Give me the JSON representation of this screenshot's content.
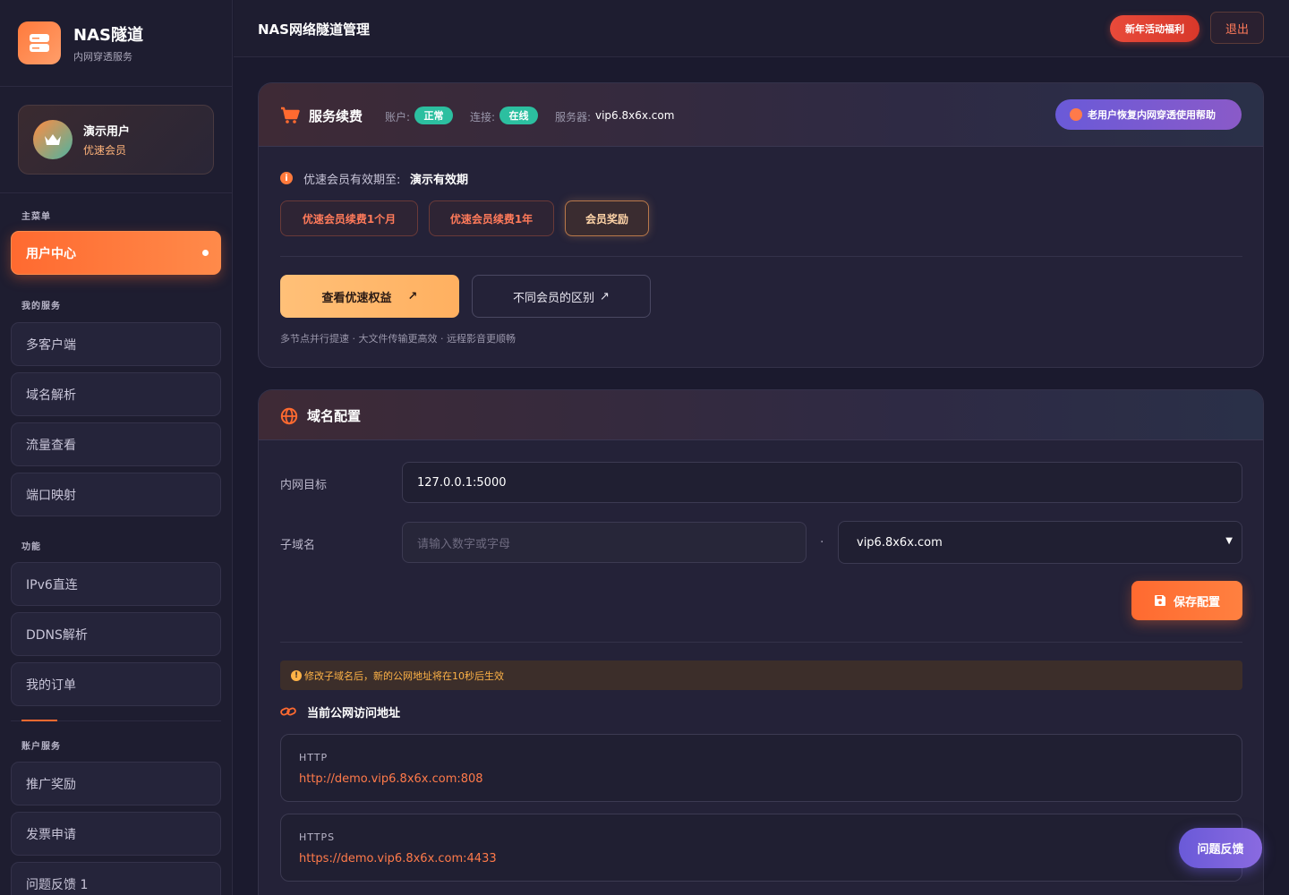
{
  "brand": {
    "name": "NAS隧道",
    "subtitle": "内网穿透服务"
  },
  "user": {
    "name": "演示用户",
    "level": "优速会员"
  },
  "sidebar": {
    "sections": {
      "main": "主菜单",
      "services": "我的服务",
      "features": "功能",
      "account": "账户服务"
    },
    "main_items": [
      {
        "label": "用户中心",
        "active": true
      }
    ],
    "service_items": [
      {
        "label": "多客户端"
      },
      {
        "label": "域名解析"
      },
      {
        "label": "流量查看"
      },
      {
        "label": "端口映射"
      }
    ],
    "feature_items": [
      {
        "label": "IPv6直连"
      },
      {
        "label": "DDNS解析"
      },
      {
        "label": "我的订单"
      }
    ],
    "account_items": [
      {
        "label": "推广奖励"
      },
      {
        "label": "发票申请"
      },
      {
        "label": "问题反馈 1"
      }
    ]
  },
  "header": {
    "title": "NAS网络隧道管理",
    "promo_label": "新年活动福利",
    "logout_label": "退出"
  },
  "renewal": {
    "title": "服务续费",
    "account_label": "账户:",
    "account_status": "正常",
    "connection_label": "连接:",
    "connection_status": "在线",
    "server_label": "服务器:",
    "server_value": "vip6.8x6x.com",
    "help_label": "老用户恢复内网穿透使用帮助",
    "expiry_label": "优速会员有效期至:",
    "expiry_value": "演示有效期",
    "buttons": [
      "优速会员续费1个月",
      "优速会员续费1年",
      "会员奖励"
    ],
    "view_benefits": "查看优速权益",
    "compare_members": "不同会员的区别",
    "arrow": "↗",
    "hint": "多节点并行提速 · 大文件传输更高效 · 远程影音更顺畅"
  },
  "domain": {
    "title": "域名配置",
    "target_label": "内网目标",
    "target_value": "127.0.0.1:5000",
    "subdomain_label": "子域名",
    "subdomain_placeholder": "请输入数字或字母",
    "separator": ".",
    "domain_select": "vip6.8x6x.com",
    "save_label": "保存配置",
    "warning": "修改子域名后，新的公网地址将在10秒后生效",
    "address_title": "当前公网访问地址",
    "urls": [
      {
        "protocol": "HTTP",
        "url": "http://demo.vip6.8x6x.com:808"
      },
      {
        "protocol": "HTTPS",
        "url": "https://demo.vip6.8x6x.com:4433"
      }
    ]
  },
  "feedback_label": "问题反馈",
  "colors": {
    "accent": "#ff6a30",
    "bg": "#1b1a2e",
    "success": "#2cbfa0",
    "purple": "#6a5ad8"
  }
}
